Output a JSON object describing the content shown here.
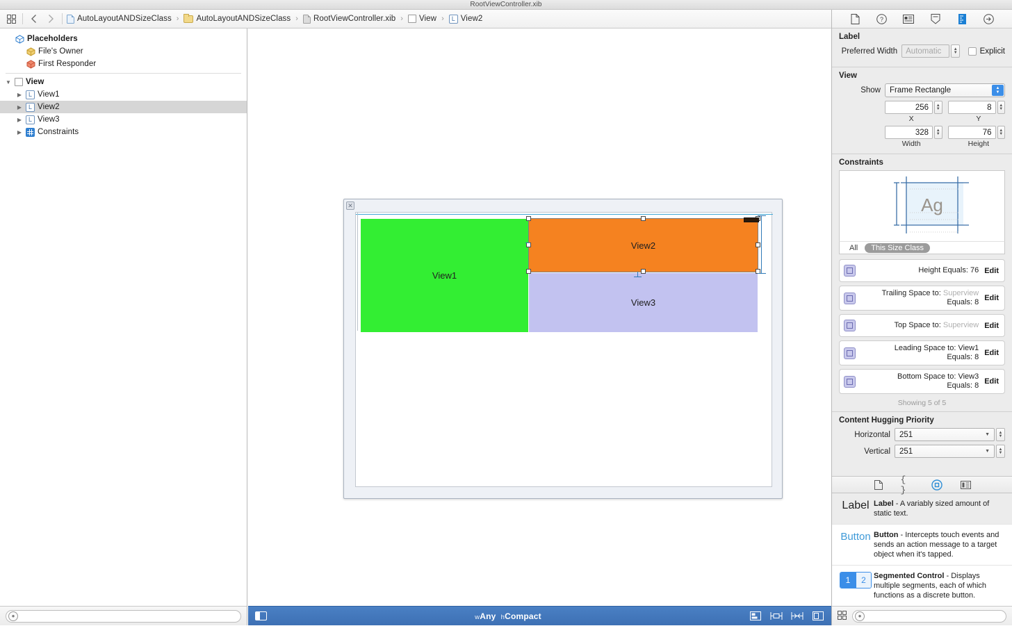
{
  "window": {
    "title": "RootViewController.xib"
  },
  "toolbar": {
    "back_icon": "chevron-left-icon",
    "forward_icon": "chevron-right-icon",
    "grid_icon": "editor-grid-icon",
    "breadcrumbs": [
      {
        "label": "AutoLayoutANDSizeClass",
        "icon": "project-document-icon"
      },
      {
        "label": "AutoLayoutANDSizeClass",
        "icon": "folder-icon"
      },
      {
        "label": "RootViewController.xib",
        "icon": "xib-file-icon"
      },
      {
        "label": "View",
        "icon": "view-square-icon"
      },
      {
        "label": "View2",
        "icon": "label-l-icon"
      }
    ],
    "separator": "›"
  },
  "outline": {
    "placeholders_header": "Placeholders",
    "placeholders": [
      {
        "label": "File's Owner",
        "icon": "files-owner-cube-icon"
      },
      {
        "label": "First Responder",
        "icon": "first-responder-cube-icon"
      }
    ],
    "tree": [
      {
        "label": "View",
        "icon": "view-square-icon",
        "twisty": "▼",
        "depth": 0,
        "bold": true,
        "selected": false
      },
      {
        "label": "View1",
        "icon": "label-l-icon",
        "twisty": "▶",
        "depth": 1,
        "bold": false,
        "selected": false
      },
      {
        "label": "View2",
        "icon": "label-l-icon",
        "twisty": "▶",
        "depth": 1,
        "bold": false,
        "selected": true
      },
      {
        "label": "View3",
        "icon": "label-l-icon",
        "twisty": "▶",
        "depth": 1,
        "bold": false,
        "selected": false
      },
      {
        "label": "Constraints",
        "icon": "constraints-grid-icon",
        "twisty": "▶",
        "depth": 1,
        "bold": false,
        "selected": false
      }
    ],
    "filter_placeholder": ""
  },
  "canvas": {
    "views": [
      {
        "name": "View1",
        "label": "View1",
        "color": "#33ee33"
      },
      {
        "name": "View2",
        "label": "View2",
        "color": "#f58220"
      },
      {
        "name": "View3",
        "label": "View3",
        "color": "#c2c2f0"
      }
    ],
    "selected_view": "View2",
    "close_glyph": "✕"
  },
  "inspector": {
    "tabs": [
      {
        "name": "file-inspector-tab",
        "icon": "document-icon",
        "active": false
      },
      {
        "name": "quick-help-tab",
        "icon": "question-circle-icon",
        "active": false
      },
      {
        "name": "identity-inspector-tab",
        "icon": "id-card-icon",
        "active": false
      },
      {
        "name": "attributes-inspector-tab",
        "icon": "slider-down-icon",
        "active": false
      },
      {
        "name": "size-inspector-tab",
        "icon": "ruler-icon",
        "active": true
      },
      {
        "name": "connections-inspector-tab",
        "icon": "arrow-right-circle-icon",
        "active": false
      }
    ],
    "label_section": {
      "title": "Label",
      "preferred_width_label": "Preferred Width",
      "preferred_width_value": "Automatic",
      "explicit_label": "Explicit",
      "explicit_checked": false
    },
    "view_section": {
      "title": "View",
      "show_label": "Show",
      "show_value": "Frame Rectangle",
      "x_value": "256",
      "x_label": "X",
      "y_value": "8",
      "y_label": "Y",
      "width_value": "328",
      "width_label": "Width",
      "height_value": "76",
      "height_label": "Height"
    },
    "constraints_section": {
      "title": "Constraints",
      "preview_glyph": "Ag",
      "scope_all": "All",
      "scope_this": "This Size Class",
      "items": [
        {
          "line1_label": "Height Equals:",
          "line1_value": "76",
          "line1_value_grey": false,
          "line2_label": "",
          "line2_value": "",
          "edit": "Edit"
        },
        {
          "line1_label": "Trailing Space to:",
          "line1_value": "Superview",
          "line1_value_grey": true,
          "line2_label": "Equals:",
          "line2_value": "8",
          "edit": "Edit"
        },
        {
          "line1_label": "Top Space to:",
          "line1_value": "Superview",
          "line1_value_grey": true,
          "line2_label": "",
          "line2_value": "",
          "edit": "Edit"
        },
        {
          "line1_label": "Leading Space to:",
          "line1_value": "View1",
          "line1_value_grey": false,
          "line2_label": "Equals:",
          "line2_value": "8",
          "edit": "Edit"
        },
        {
          "line1_label": "Bottom Space to:",
          "line1_value": "View3",
          "line1_value_grey": false,
          "line2_label": "Equals:",
          "line2_value": "8",
          "edit": "Edit"
        }
      ],
      "showing": "Showing 5 of 5"
    },
    "hugging_section": {
      "title": "Content Hugging Priority",
      "horizontal_label": "Horizontal",
      "horizontal_value": "251",
      "vertical_label": "Vertical",
      "vertical_value": "251"
    }
  },
  "library": {
    "tabs": [
      {
        "name": "file-template-library-tab",
        "icon": "page-icon",
        "active": false
      },
      {
        "name": "code-snippet-library-tab",
        "icon": "braces-icon",
        "active": false
      },
      {
        "name": "object-library-tab",
        "icon": "circle-target-icon",
        "active": true
      },
      {
        "name": "media-library-tab",
        "icon": "media-list-icon",
        "active": false
      }
    ],
    "items": [
      {
        "preview": "Label",
        "title": "Label",
        "desc": " - A variably sized amount of static text.",
        "selected": true
      },
      {
        "preview": "Button",
        "title": "Button",
        "desc": " - Intercepts touch events and sends an action message to a target object when it's tapped.",
        "selected": false
      },
      {
        "preview_segments": [
          "1",
          "2"
        ],
        "title": "Segmented Control",
        "desc": " - Displays multiple segments, each of which functions as a discrete button.",
        "selected": false
      }
    ],
    "filter_placeholder": ""
  },
  "bottombar": {
    "panel_toggle_icon": "left-panel-toggle-icon",
    "size_class_prefix_w": "w",
    "size_class_w": "Any",
    "size_class_prefix_h": "h",
    "size_class_h": "Compact",
    "right_icons": [
      {
        "name": "align-button",
        "icon": "align-icon"
      },
      {
        "name": "pin-button",
        "icon": "pin-icon"
      },
      {
        "name": "resolve-issues-button",
        "icon": "resolve-icon"
      },
      {
        "name": "resizing-behavior-button",
        "icon": "resize-icon"
      }
    ]
  },
  "colors": {
    "accent_blue": "#3b8ee8",
    "bottom_bar": "#4a80c4",
    "view1": "#33ee33",
    "view2": "#f58220",
    "view3": "#c2c2f0",
    "constraint_icon": "#c9c9ec"
  }
}
